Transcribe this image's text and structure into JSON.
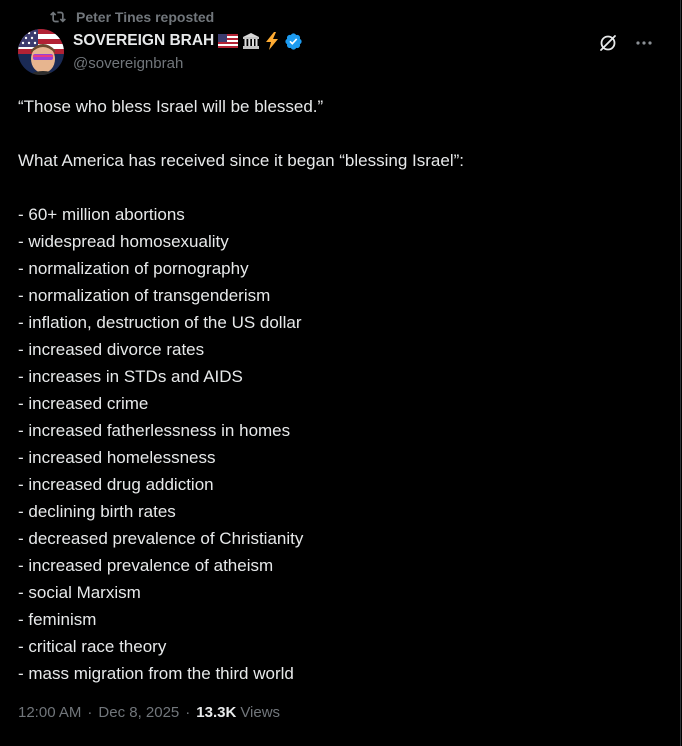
{
  "repost": {
    "icon": "repost-icon",
    "text": "Peter Tines reposted"
  },
  "author": {
    "name": "SOVEREIGN BRAH",
    "handle": "@sovereignbrah",
    "name_emojis": [
      "us-flag-emoji",
      "classical-building-emoji",
      "lightning-emoji"
    ],
    "verified_badge": "verified-badge-icon",
    "verified_color": "#1d9bf0"
  },
  "actions": {
    "grok_icon": "grok-icon",
    "more_icon": "more-icon"
  },
  "tweet": {
    "intro": "“Those who bless Israel will be blessed.”",
    "lead": "What America has received since it began “blessing Israel”:",
    "items": [
      "- 60+ million abortions",
      "- widespread homosexuality",
      "- normalization of pornography",
      "- normalization of transgenderism",
      "- inflation, destruction of the US dollar",
      "- increased divorce rates",
      "- increases in STDs and AIDS",
      "- increased crime",
      "- increased fatherlessness in homes",
      "- increased homelessness",
      "- increased drug addiction",
      "- declining birth rates",
      "- decreased prevalence of Christianity",
      "- increased prevalence of atheism",
      "- social Marxism",
      "- feminism",
      "- critical race theory",
      "- mass migration from the third world"
    ]
  },
  "meta": {
    "time": "12:00 AM",
    "date": "Dec 8, 2025",
    "separator": "·",
    "views_count": "13.3K",
    "views_label": "Views"
  },
  "colors": {
    "background": "#000000",
    "text": "#e7e9ea",
    "muted": "#71767b",
    "border": "#2f3336"
  }
}
